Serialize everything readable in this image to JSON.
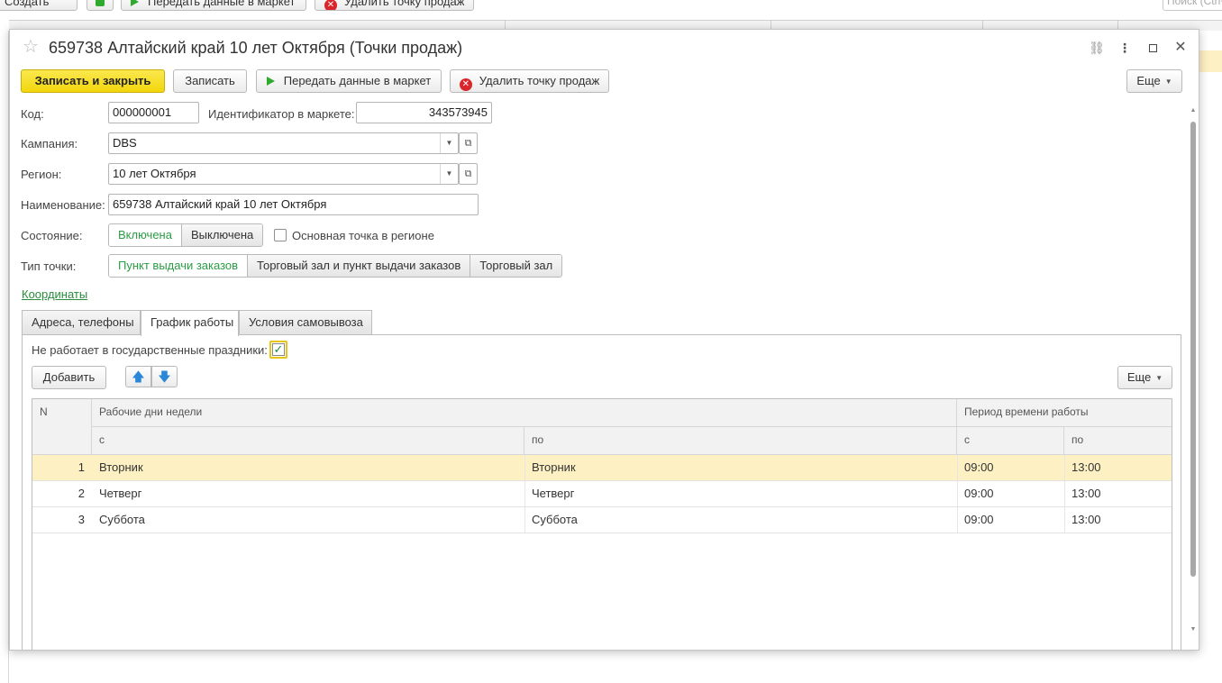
{
  "background": {
    "toolbar": {
      "create_label": "Создать",
      "send_label": "Передать данные в маркет",
      "delete_label": "Удалить точку продаж",
      "search_placeholder": "Поиск (Ctrl+F)"
    }
  },
  "window": {
    "title": "659738 Алтайский край 10 лет Октября (Точки продаж)",
    "icons": [
      "link-icon",
      "more-icon",
      "maximize-icon",
      "close-icon"
    ]
  },
  "toolbar": {
    "save_close_label": "Записать и закрыть",
    "save_label": "Записать",
    "send_label": "Передать данные в маркет",
    "delete_label": "Удалить точку продаж",
    "more_label": "Еще"
  },
  "form": {
    "code_label": "Код:",
    "code_value": "000000001",
    "market_id_label": "Идентификатор в маркете:",
    "market_id_value": "343573945",
    "campaign_label": "Кампания:",
    "campaign_value": "DBS",
    "region_label": "Регион:",
    "region_value": "10 лет Октября",
    "name_label": "Наименование:",
    "name_value": "659738 Алтайский край 10 лет Октября",
    "state_label": "Состояние:",
    "state_options": [
      "Включена",
      "Выключена"
    ],
    "state_selected": "Включена",
    "main_point_label": "Основная точка в регионе",
    "main_point_checked": false,
    "point_type_label": "Тип точки:",
    "point_type_options": [
      "Пункт выдачи заказов",
      "Торговый зал и пункт выдачи заказов",
      "Торговый зал"
    ],
    "point_type_selected": "Пункт выдачи заказов",
    "coordinates_link": "Координаты"
  },
  "tabs": [
    {
      "label": "Адреса, телефоны",
      "active": false
    },
    {
      "label": "График работы",
      "active": true
    },
    {
      "label": "Условия самовывоза",
      "active": false
    }
  ],
  "schedule": {
    "holidays_label": "Не работает в государственные праздники:",
    "holidays_checked": true,
    "add_label": "Добавить",
    "more_label": "Еще",
    "columns": {
      "n": "N",
      "days_group": "Рабочие дни недели",
      "days_from": "с",
      "days_to": "по",
      "period_group": "Период времени работы",
      "period_from": "с",
      "period_to": "по"
    },
    "rows": [
      {
        "n": "1",
        "day_from": "Вторник",
        "day_to": "Вторник",
        "time_from": "09:00",
        "time_to": "13:00",
        "selected": true
      },
      {
        "n": "2",
        "day_from": "Четверг",
        "day_to": "Четверг",
        "time_from": "09:00",
        "time_to": "13:00",
        "selected": false
      },
      {
        "n": "3",
        "day_from": "Суббота",
        "day_to": "Суббота",
        "time_from": "09:00",
        "time_to": "13:00",
        "selected": false
      }
    ]
  },
  "colors": {
    "primary_button": "#f2d60c",
    "selected_row": "#fdf1c4",
    "active_green": "#2a9d45"
  }
}
